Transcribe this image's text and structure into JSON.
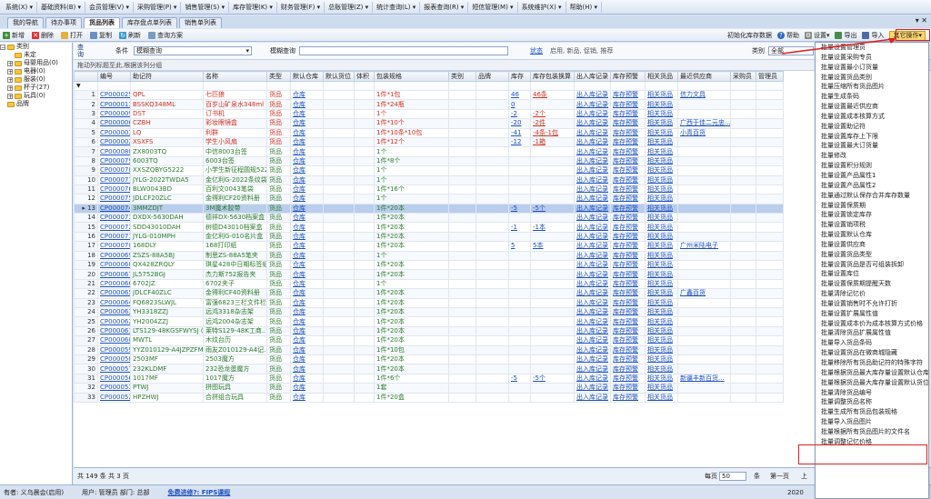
{
  "menu": [
    "系统(X) ▾",
    "基础资料(B) ▾",
    "会员管理(V) ▾",
    "采购管理(P) ▾",
    "销售管理(S) ▾",
    "库存管理(K) ▾",
    "财务管理(F) ▾",
    "总账管理(Z) ▾",
    "统计查询(L) ▾",
    "报表查询(R) ▾",
    "短信管理(M) ▾",
    "系统维护(X) ▾",
    "帮助(H) ▾"
  ],
  "tabs": [
    "我的导航",
    "待办事项",
    "货品列表",
    "库存盘点单列表",
    "销售单列表"
  ],
  "toolbar": {
    "new": "新增",
    "delete": "删除",
    "open": "打开",
    "copy": "复制",
    "refresh": "刷新",
    "query_plan": "查询方案",
    "init_stock": "初始化库存数据",
    "help": "帮助",
    "settings": "设置",
    "export": "导出",
    "import": "导入",
    "more": "其它操作"
  },
  "tree": {
    "root": "类别",
    "items": [
      "未定",
      "母婴用品(0)",
      "电器(0)",
      "服装(0)",
      "杯子(27)",
      "玩具(0)"
    ],
    "other": "品牌"
  },
  "query": {
    "label": "查询",
    "cond_label": "条件",
    "cond_value": "模糊查询",
    "fuzzy_label": "模糊查询",
    "status_label": "状态",
    "status_value": "启用, 新品, 促销, 推荐",
    "cat_label": "类别",
    "cat_value": "全部"
  },
  "group_hint": "拖动列标题至此,根据该列分组",
  "columns": [
    "",
    "编号",
    "助记符",
    "名称",
    "类型",
    "默认仓库",
    "默认货位",
    "体积",
    "包装规格",
    "类别",
    "品牌",
    "库存",
    "库存包装换算",
    "出入库记录",
    "库存预警",
    "相关货品",
    "最近供应商",
    "采购员",
    "管理员"
  ],
  "rows": [
    [
      "1",
      "CP000029",
      "QPL",
      "七匹狼",
      "货品",
      "仓库",
      "",
      "",
      "1件*1包",
      "",
      "",
      "46",
      "46条",
      "出入库记录",
      "库存预警",
      "相关货品",
      "信力文具",
      "",
      ""
    ],
    [
      "2",
      "CP000013",
      "BSSKQ348ML",
      "百岁山矿泉水348ml",
      "货品",
      "仓库",
      "",
      "",
      "1件*24瓶",
      "",
      "",
      "0",
      "",
      "出入库记录",
      "库存预警",
      "相关货品",
      "",
      "",
      ""
    ],
    [
      "3",
      "CP000009",
      "DST",
      "订书机",
      "货品",
      "仓库",
      "",
      "",
      "1个",
      "",
      "",
      "-2",
      "-2个",
      "出入库记录",
      "库存预警",
      "相关货品",
      "",
      "",
      ""
    ],
    [
      "4",
      "CP000006",
      "CZBH",
      "彩妆眼镜盒",
      "货品",
      "仓库",
      "",
      "",
      "1件*10个",
      "",
      "",
      "-20",
      "-2件",
      "出入库记录",
      "库存预警",
      "相关货品",
      "广西于佳二元忠...",
      "",
      ""
    ],
    [
      "5",
      "CP000003",
      "LQ",
      "利群",
      "货品",
      "仓库",
      "",
      "",
      "1件*10条*10包",
      "",
      "",
      "-41",
      "-4条-1包",
      "出入库记录",
      "库存预警",
      "相关货品",
      "小青百货",
      "",
      ""
    ],
    [
      "6",
      "CP000002",
      "XSXFS",
      "学生小风扇",
      "货品",
      "仓库",
      "",
      "",
      "1件*12个",
      "",
      "",
      "-12",
      "-1箱",
      "出入库记录",
      "库存预警",
      "相关货品",
      "",
      "",
      ""
    ],
    [
      "7",
      "CP000080",
      "ZX8003TQ",
      "中信8003台签",
      "货品",
      "仓库",
      "",
      "",
      "1个",
      "",
      "",
      "",
      "",
      "出入库记录",
      "库存预警",
      "相关货品",
      "",
      "",
      ""
    ],
    [
      "8",
      "CP000079",
      "6003TQ",
      "6003台签",
      "货品",
      "仓库",
      "",
      "",
      "1件*8个",
      "",
      "",
      "",
      "",
      "出入库记录",
      "库存预警",
      "相关货品",
      "",
      "",
      ""
    ],
    [
      "9",
      "CP000078",
      "XXSZQBYG5222",
      "小学生新征程圆规5222",
      "货品",
      "仓库",
      "",
      "",
      "1个",
      "",
      "",
      "",
      "",
      "出入库记录",
      "库存预警",
      "相关货品",
      "",
      "",
      ""
    ],
    [
      "10",
      "CP000077",
      "JYLG-2022TWDA5",
      "金亿利G-2022条纹袋A5",
      "货品",
      "仓库",
      "",
      "",
      "1个",
      "",
      "",
      "",
      "",
      "出入库记录",
      "库存预警",
      "相关货品",
      "",
      "",
      ""
    ],
    [
      "11",
      "CP000076",
      "BLW0043BD",
      "百利文0043笔袋",
      "货品",
      "仓库",
      "",
      "",
      "1件*16个",
      "",
      "",
      "",
      "",
      "出入库记录",
      "库存预警",
      "相关货品",
      "",
      "",
      ""
    ],
    [
      "12",
      "CP000075",
      "JDLCF20ZLC",
      "金得利CF20资料册",
      "货品",
      "仓库",
      "",
      "",
      "1个",
      "",
      "",
      "",
      "",
      "出入库记录",
      "库存预警",
      "相关货品",
      "",
      "",
      ""
    ],
    [
      "13",
      "CP000074",
      "3MMZDJT",
      "3M魔术胶带",
      "货品",
      "仓库",
      "",
      "",
      "1件*20本",
      "",
      "",
      "-5",
      "-5个",
      "出入库记录",
      "库存预警",
      "相关货品",
      "",
      "",
      ""
    ],
    [
      "14",
      "CP000073",
      "DXDX-5630DAH",
      "德祥DX-5630档案盒",
      "货品",
      "仓库",
      "",
      "",
      "1件*20本",
      "",
      "",
      "",
      "",
      "出入库记录",
      "库存预警",
      "相关货品",
      "",
      "",
      ""
    ],
    [
      "15",
      "CP000072",
      "SDD43010DAH",
      "树德D43010档案盒",
      "货品",
      "仓库",
      "",
      "",
      "1件*20本",
      "",
      "",
      "-1",
      "-1本",
      "出入库记录",
      "库存预警",
      "相关货品",
      "",
      "",
      ""
    ],
    [
      "16",
      "CP000071",
      "JYLG-010MPH",
      "金亿利G-010名片盒",
      "货品",
      "仓库",
      "",
      "",
      "1件*20本",
      "",
      "",
      "",
      "",
      "出入库记录",
      "库存预警",
      "相关货品",
      "",
      "",
      ""
    ],
    [
      "17",
      "CP000070",
      "168DLY",
      "168打印纸",
      "货品",
      "仓库",
      "",
      "",
      "1件*20本",
      "",
      "",
      "5",
      "5本",
      "出入库记录",
      "库存预警",
      "相关货品",
      "广州米陆电子",
      "",
      ""
    ],
    [
      "18",
      "CP000069",
      "ZSZS-88A5BJ",
      "制思ZS-88A5笔夹",
      "货品",
      "仓库",
      "",
      "",
      "1个",
      "",
      "",
      "",
      "",
      "出入库记录",
      "库存预警",
      "相关货品",
      "",
      "",
      ""
    ],
    [
      "19",
      "CP000068",
      "QX428ZRQLY",
      "琪星428中日期标签纸",
      "货品",
      "仓库",
      "",
      "",
      "1件*20本",
      "",
      "",
      "",
      "",
      "出入库记录",
      "库存预警",
      "相关货品",
      "",
      "",
      ""
    ],
    [
      "20",
      "CP000067",
      "JL5752BGJ",
      "杰力斯752报告夹",
      "货品",
      "仓库",
      "",
      "",
      "1件*20本",
      "",
      "",
      "",
      "",
      "出入库记录",
      "库存预警",
      "相关货品",
      "",
      "",
      ""
    ],
    [
      "21",
      "CP000066",
      "6702JZ",
      "6702夹子",
      "货品",
      "仓库",
      "",
      "",
      "1个",
      "",
      "",
      "",
      "",
      "出入库记录",
      "库存预警",
      "相关货品",
      "",
      "",
      ""
    ],
    [
      "22",
      "CP000065",
      "JDLCF40ZLC",
      "金得利CF40资料册",
      "货品",
      "仓库",
      "",
      "",
      "1件*20本",
      "",
      "",
      "",
      "",
      "出入库记录",
      "库存预警",
      "相关货品",
      "广鑫百货",
      "",
      ""
    ],
    [
      "23",
      "CP000064",
      "FQ6823SLWJL",
      "富强6823三栏文件栏",
      "货品",
      "仓库",
      "",
      "",
      "1件*20本",
      "",
      "",
      "",
      "",
      "出入库记录",
      "库存预警",
      "相关货品",
      "",
      "",
      ""
    ],
    [
      "24",
      "CP000063",
      "YH3318ZZJ",
      "远鸿3318杂志架",
      "货品",
      "仓库",
      "",
      "",
      "1件*20本",
      "",
      "",
      "",
      "",
      "出入库记录",
      "库存预警",
      "相关货品",
      "",
      "",
      ""
    ],
    [
      "25",
      "CP000062",
      "YH2004ZZJ",
      "远鸿2004杂志架",
      "货品",
      "仓库",
      "",
      "",
      "1件*20本",
      "",
      "",
      "",
      "",
      "出入库记录",
      "库存预警",
      "相关货品",
      "",
      "",
      ""
    ],
    [
      "26",
      "CP000061",
      "LTS129-48KGSFWYSJ (...",
      "莱特S129-48K工商...",
      "货品",
      "仓库",
      "",
      "",
      "1件*20本",
      "",
      "",
      "",
      "",
      "出入库记录",
      "库存预警",
      "相关货品",
      "",
      "",
      ""
    ],
    [
      "27",
      "CP000060",
      "MWTL",
      "木纹台历",
      "货品",
      "仓库",
      "",
      "",
      "1件*20本",
      "",
      "",
      "",
      "",
      "出入库记录",
      "库存预警",
      "相关货品",
      "",
      "",
      ""
    ],
    [
      "28",
      "CP000059",
      "YYZ010129-A4JZPZFM",
      "雨友Z010129-A4记...",
      "货品",
      "仓库",
      "",
      "",
      "1件*10包",
      "",
      "",
      "",
      "",
      "出入库记录",
      "库存预警",
      "相关货品",
      "",
      "",
      ""
    ],
    [
      "29",
      "CP000058",
      "2503MF",
      "2503魔方",
      "货品",
      "仓库",
      "",
      "",
      "1件*20本",
      "",
      "",
      "",
      "",
      "出入库记录",
      "库存预警",
      "相关货品",
      "",
      "",
      ""
    ],
    [
      "30",
      "CP000057",
      "232KLDMF",
      "232恐龙蛋魔方",
      "货品",
      "仓库",
      "",
      "",
      "1件*20本",
      "",
      "",
      "",
      "",
      "出入库记录",
      "库存预警",
      "相关货品",
      "",
      "",
      ""
    ],
    [
      "31",
      "CP000056",
      "1017MF",
      "1017魔方",
      "货品",
      "仓库",
      "",
      "",
      "1件*6个",
      "",
      "",
      "-5",
      "-5个",
      "出入库记录",
      "库存预警",
      "相关货品",
      "新疆丰新百货...",
      "",
      ""
    ],
    [
      "32",
      "CP000053",
      "PTWJ",
      "拼图玩具",
      "货品",
      "仓库",
      "",
      "",
      "1套",
      "",
      "",
      "",
      "",
      "出入库记录",
      "库存预警",
      "相关货品",
      "",
      "",
      ""
    ],
    [
      "33",
      "CP000052",
      "HPZHWJ",
      "合拼组合玩具",
      "货品",
      "仓库",
      "",
      "",
      "1件*20盒",
      "",
      "",
      "",
      "",
      "出入库记录",
      "库存预警",
      "相关货品",
      "",
      "",
      ""
    ]
  ],
  "footer": {
    "total": "共 149 条 共 3 页",
    "per_page_label": "每页",
    "per_page": "50",
    "unit": "条",
    "first": "第一页",
    "last": "上"
  },
  "status": {
    "user": "有者: 义乌晨会(启用)",
    "op": "用户: 管理员 部门: 总部",
    "link": "免费进修?: FIPS课程",
    "time": "2020"
  },
  "dropdown": [
    "批量设置管理员",
    "批量设置采购专员",
    "批量设置最小订货量",
    "批量设置货品类别",
    "批量压缩所有货品图片",
    "批量生成条码",
    "批量设置最近供应商",
    "批量设置成本核算方式",
    "批量设置助记符",
    "批量设置库存上下限",
    "批量设置最大订货量",
    "批量修改",
    "批量设置积分规则",
    "批量设置产品属性1",
    "批量设置产品属性2",
    "批量通过默认保存合并库存数量",
    "批量设置保质期",
    "批量设置锁定库存",
    "批量设置销项税",
    "批量设置默认仓库",
    "批量设置供应商",
    "批量设置货品类型",
    "批量设置货品是否可组装拆卸",
    "批量设置库位",
    "批量设置保质期提醒天数",
    "批量清除记忆价",
    "批量设置销售时不允许打折",
    "批量设置扩展属性值",
    "批量设置成本价为成本核算方式价格",
    "批量清除货品扩展属性值",
    "批量导入货品条码",
    "批量设置货品在微商城隐藏",
    "批量移除所有货品助记符的特殊字符",
    "批量根据货品最大库存量设置默认仓库",
    "批量根据货品最大库存量设置默认货位",
    "批量清除货品编号",
    "批量调整货品名称",
    "批量生成所有货品包装规格",
    "批量导入货品图片",
    "批量根据所有货品图片的文件名",
    "批量调整记忆价格"
  ]
}
